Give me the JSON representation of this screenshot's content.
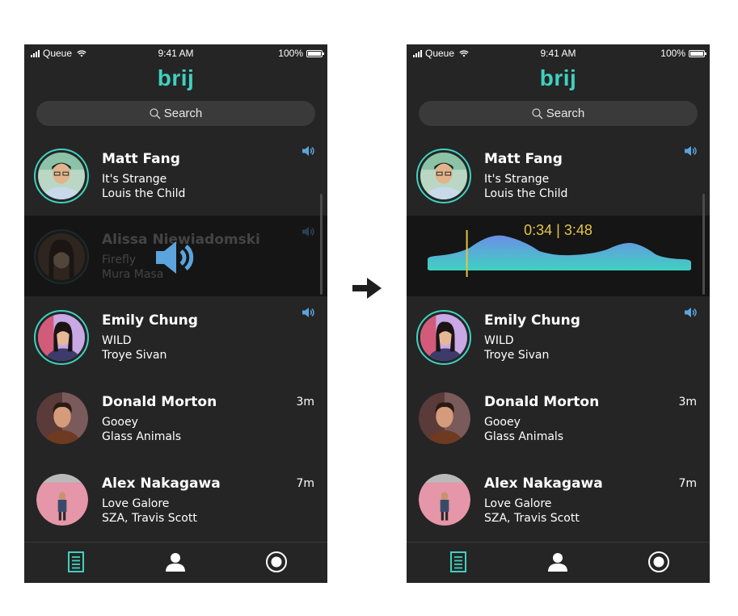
{
  "status_bar": {
    "carrier": "Queue",
    "time": "9:41 AM",
    "battery": "100%"
  },
  "app": {
    "logo": "brij",
    "accent_color": "#3fd1c0",
    "waveform_time_color": "#e3c447",
    "speaker_icon_color": "#5ba4dd"
  },
  "search": {
    "label": "Search",
    "icon": "search-icon"
  },
  "left_screen": {
    "feed": [
      {
        "name": "Matt Fang",
        "song": "It's Strange",
        "artist": "Louis the Child",
        "meta": "",
        "indicator": "speaker-icon",
        "ring": true
      },
      {
        "name": "Alissa Niewiadomski",
        "song": "Firefly",
        "artist": "Mura Masa",
        "meta": "",
        "indicator": "speaker-icon",
        "ring": true,
        "state": "playing"
      },
      {
        "name": "Emily Chung",
        "song": "WILD",
        "artist": "Troye Sivan",
        "meta": "",
        "indicator": "speaker-icon",
        "ring": true
      },
      {
        "name": "Donald Morton",
        "song": "Gooey",
        "artist": "Glass Animals",
        "meta": "3m",
        "ring": false
      },
      {
        "name": "Alex Nakagawa",
        "song": "Love Galore",
        "artist": "SZA, Travis Scott",
        "meta": "7m",
        "ring": false
      }
    ]
  },
  "right_screen": {
    "feed": [
      {
        "name": "Matt Fang",
        "song": "It's Strange",
        "artist": "Louis the Child",
        "meta": ""
      },
      {
        "name": "Emily Chung",
        "song": "WILD",
        "artist": "Troye Sivan",
        "meta": ""
      },
      {
        "name": "Donald Morton",
        "song": "Gooey",
        "artist": "Glass Animals",
        "meta": "3m"
      },
      {
        "name": "Alex Nakagawa",
        "song": "Love Galore",
        "artist": "SZA, Travis Scott",
        "meta": "7m"
      }
    ],
    "player": {
      "elapsed": "0:34",
      "total": "3:48",
      "display": "0:34 | 3:48",
      "progress_fraction": 0.149
    }
  },
  "tab_bar": {
    "items": [
      {
        "name": "feed",
        "icon": "feed-list-icon",
        "active": true
      },
      {
        "name": "profile",
        "icon": "person-icon",
        "active": false
      },
      {
        "name": "record",
        "icon": "record-icon",
        "active": false
      }
    ]
  },
  "transition": {
    "icon": "arrow-right-icon"
  }
}
